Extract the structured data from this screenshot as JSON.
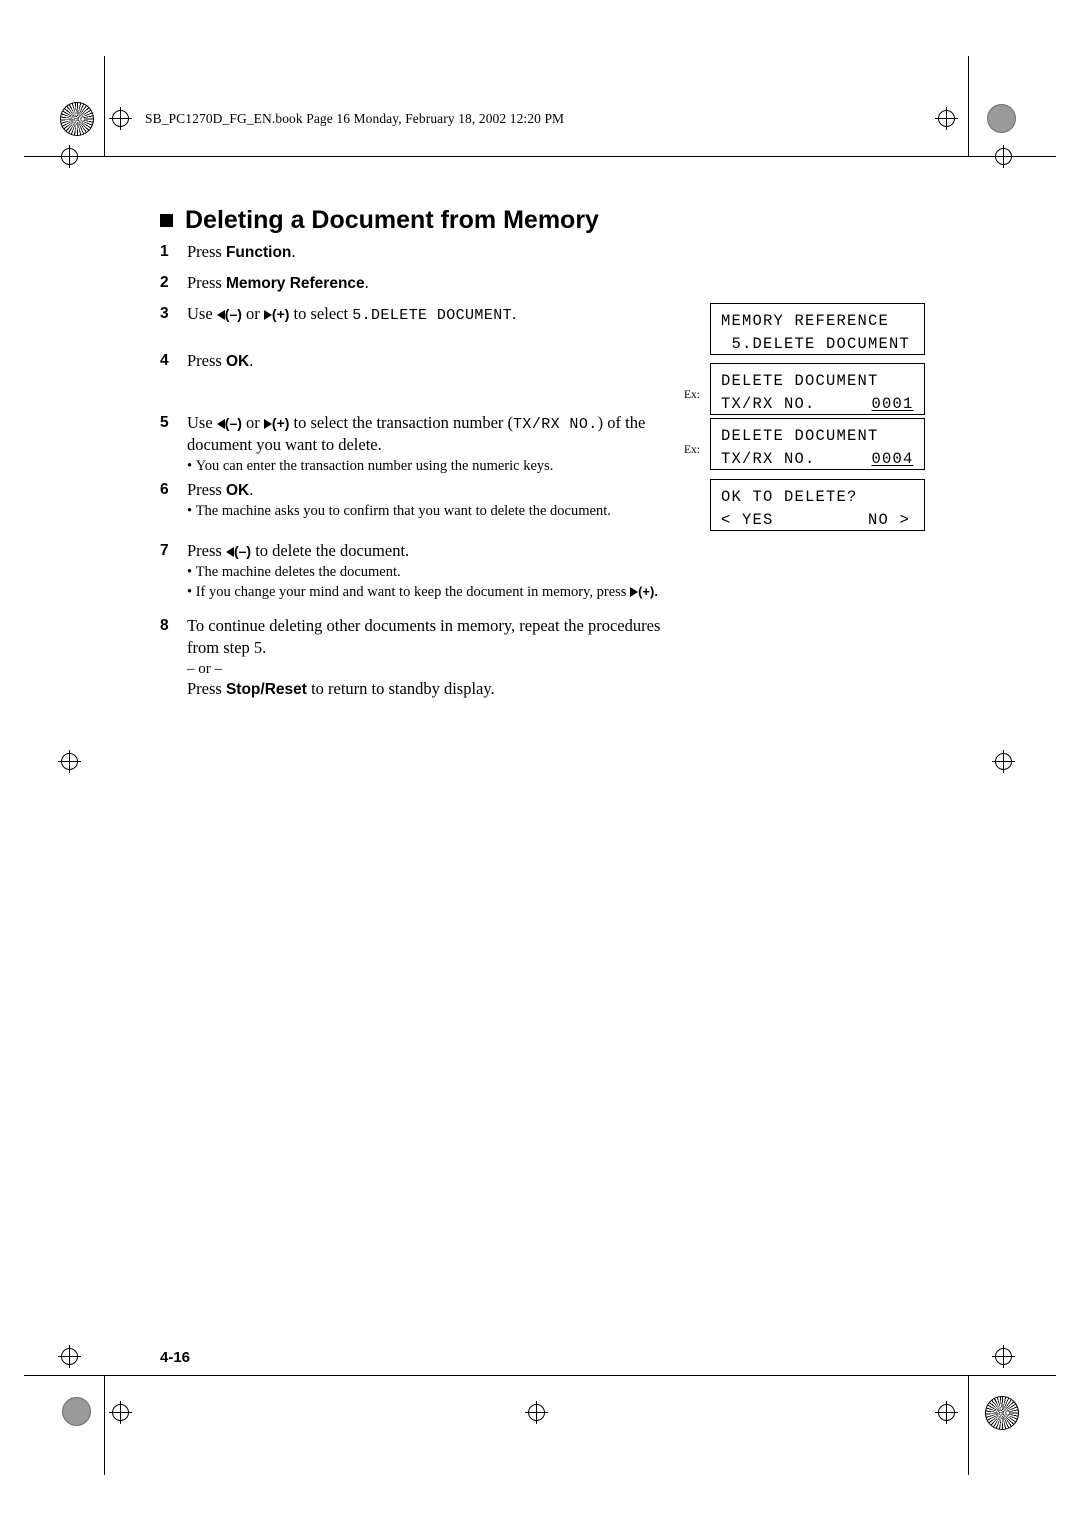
{
  "header": {
    "text": "SB_PC1270D_FG_EN.book  Page 16  Monday, February 18, 2002  12:20 PM"
  },
  "section": {
    "title": "Deleting a Document from Memory"
  },
  "steps": [
    {
      "num": "1",
      "pre": "Press ",
      "bold": "Function",
      "post": "."
    },
    {
      "num": "2",
      "pre": "Press ",
      "bold": "Memory Reference",
      "post": "."
    },
    {
      "num": "3",
      "pre": "Use ",
      "minus": "(–)",
      "mid": " or ",
      "plus": "(+)",
      "post": " to select ",
      "mono": "5.DELETE DOCUMENT",
      "end": "."
    },
    {
      "num": "4",
      "pre": "Press ",
      "bold": "OK",
      "post": "."
    },
    {
      "num": "5",
      "pre": "Use ",
      "minus": "(–)",
      "mid": " or ",
      "plus": "(+)",
      "post": " to select the transaction number (",
      "mono": "TX/RX NO.",
      "end": ") of the",
      "line2": "document you want to delete.",
      "bullets": [
        "You can enter the transaction number using the numeric keys."
      ]
    },
    {
      "num": "6",
      "pre": "Press ",
      "bold": "OK",
      "post": ".",
      "bullets": [
        "The machine asks you to confirm that you want to delete the document."
      ]
    },
    {
      "num": "7",
      "pre": "Press ",
      "minus": "(–)",
      "post": " to delete the document.",
      "bullets": [
        "The machine deletes the document.",
        "If you change your mind and want to keep the document in memory, press "
      ],
      "bullet2_tail": "(+)."
    },
    {
      "num": "8",
      "line1": "To continue deleting other documents in memory, repeat the procedures",
      "line2": "from step 5.",
      "or": "– or –",
      "press_pre": "Press ",
      "press_bold": "Stop/Reset",
      "press_post": " to return to standby display."
    }
  ],
  "lcds": [
    {
      "line1": "MEMORY REFERENCE",
      "line2": " 5.DELETE DOCUMENT",
      "ex": ""
    },
    {
      "line1": "DELETE DOCUMENT",
      "line2": "TX/RX NO.",
      "value": "0001",
      "ex": "Ex:"
    },
    {
      "line1": "DELETE DOCUMENT",
      "line2": "TX/RX NO.",
      "value": "0004",
      "ex": "Ex:"
    },
    {
      "line1": "OK TO DELETE?",
      "line2": "< YES         NO >",
      "ex": ""
    }
  ],
  "footer": {
    "page_number": "4-16"
  }
}
